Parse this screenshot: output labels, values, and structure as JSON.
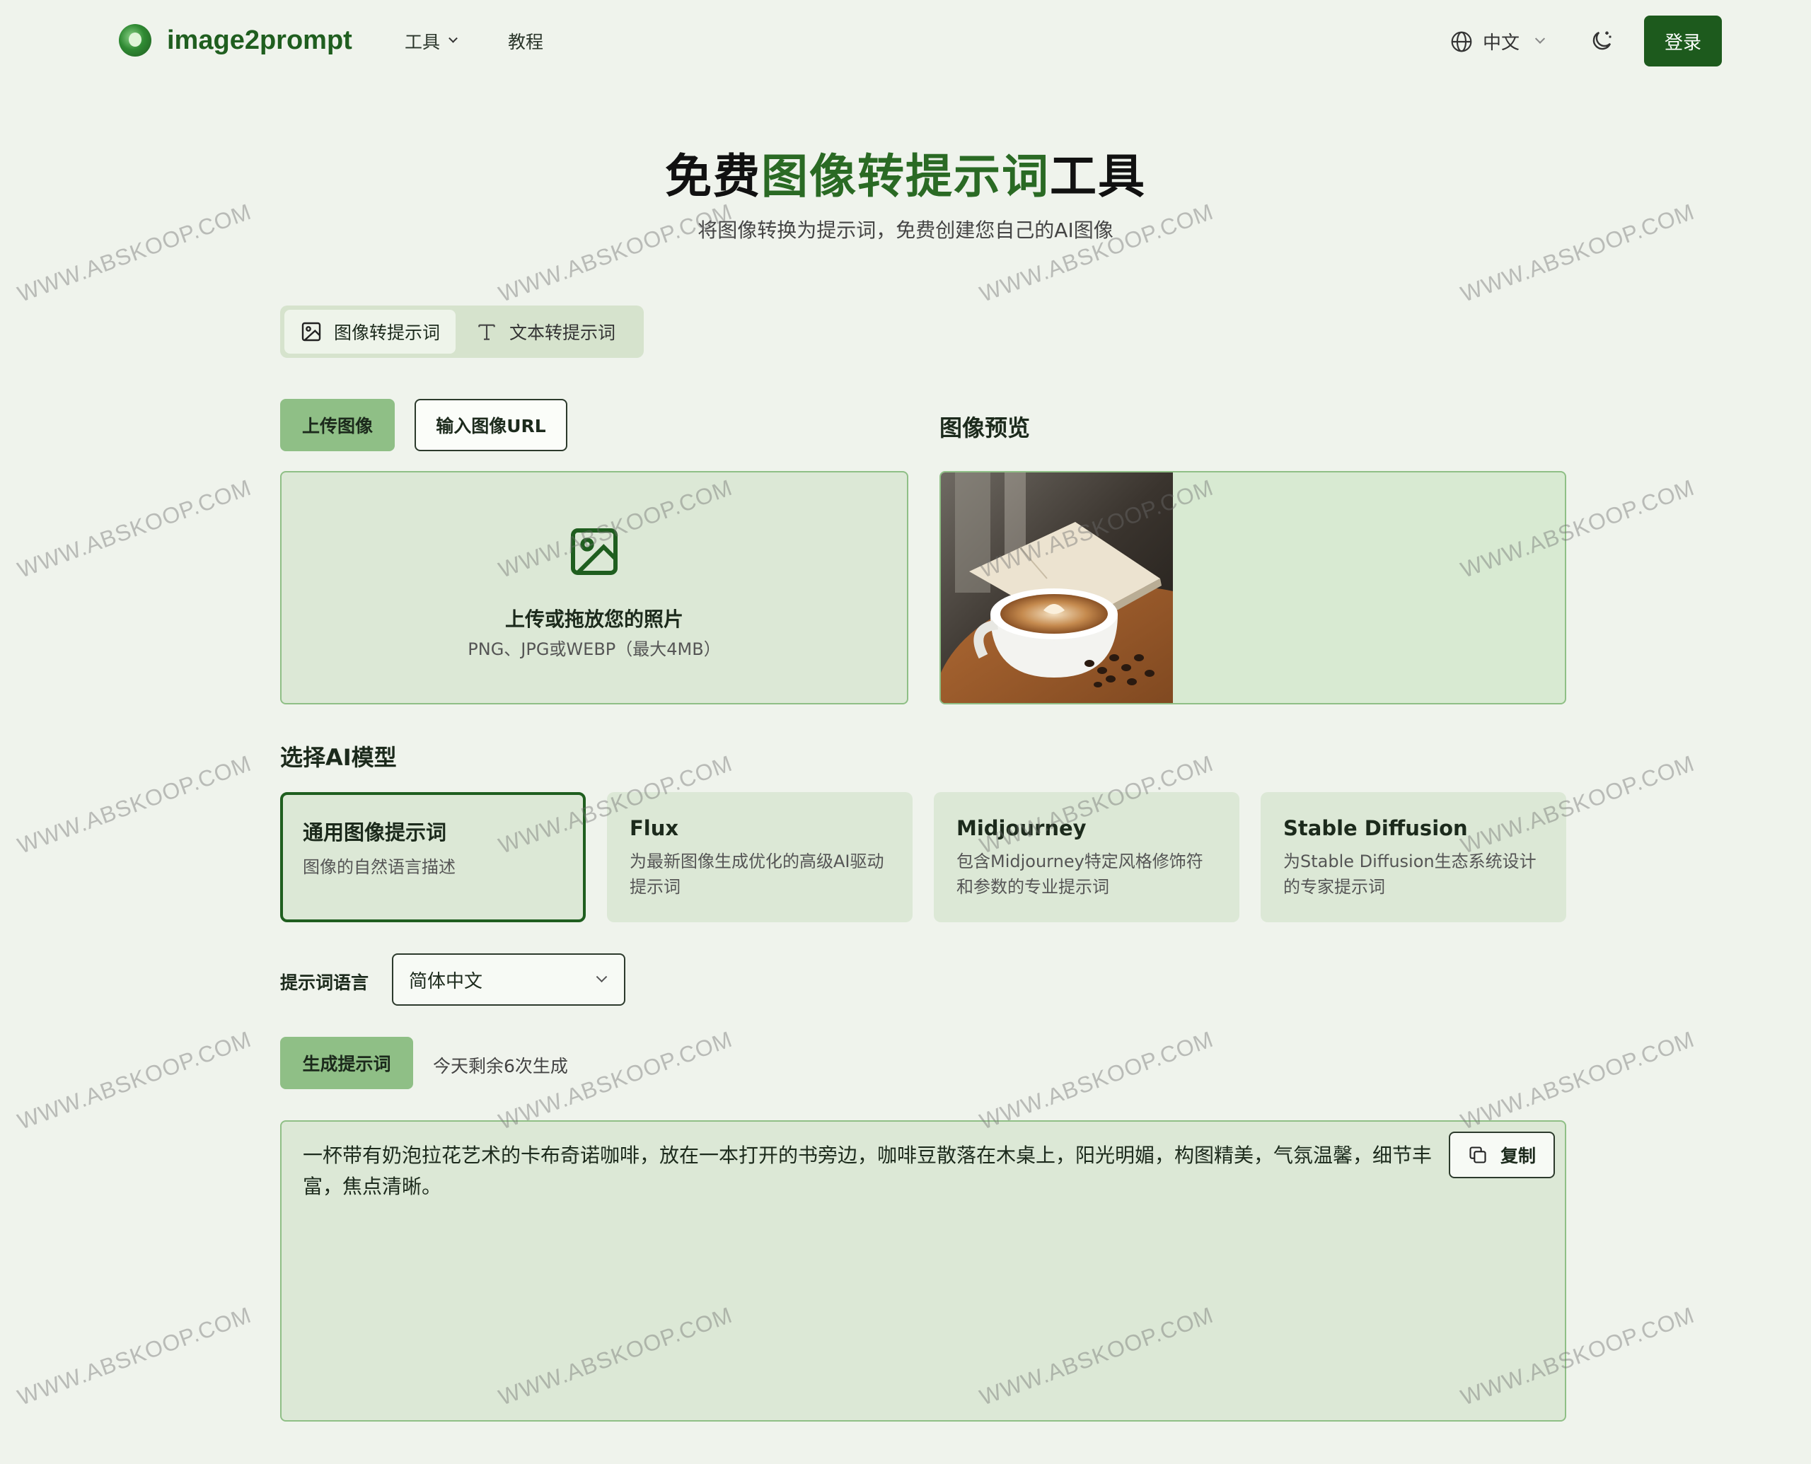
{
  "nav": {
    "brand": "image2prompt",
    "tools_label": "工具",
    "tutorial_label": "教程",
    "language_label": "中文",
    "login_label": "登录"
  },
  "hero": {
    "title_prefix": "免费",
    "title_accent": "图像转提示词",
    "title_suffix": "工具",
    "subtitle": "将图像转换为提示词，免费创建您自己的AI图像"
  },
  "mode_tabs": [
    {
      "label": "图像转提示词",
      "icon": "image-icon",
      "active": true
    },
    {
      "label": "文本转提示词",
      "icon": "text-icon",
      "active": false
    }
  ],
  "upload": {
    "upload_label": "上传图像",
    "url_label": "输入图像URL",
    "drop_title": "上传或拖放您的照片",
    "drop_sub": "PNG、JPG或WEBP（最大4MB）",
    "preview_title": "图像预览"
  },
  "models": {
    "title": "选择AI模型",
    "items": [
      {
        "title": "通用图像提示词",
        "desc": "图像的自然语言描述",
        "active": true
      },
      {
        "title": "Flux",
        "desc": "为最新图像生成优化的高级AI驱动提示词",
        "active": false
      },
      {
        "title": "Midjourney",
        "desc": "包含Midjourney特定风格修饰符和参数的专业提示词",
        "active": false
      },
      {
        "title": "Stable Diffusion",
        "desc": "为Stable Diffusion生态系统设计的专家提示词",
        "active": false
      }
    ]
  },
  "prompt_language": {
    "label": "提示词语言",
    "value": "简体中文"
  },
  "generate": {
    "label": "生成提示词",
    "remaining": "今天剩余6次生成"
  },
  "output": {
    "text": "一杯带有奶泡拉花艺术的卡布奇诺咖啡，放在一本打开的书旁边，咖啡豆散落在木桌上，阳光明媚，构图精美，气氛温馨，细节丰富，焦点清晰。",
    "copy_label": "复制"
  },
  "watermark": "WWW.ABSKOOP.COM",
  "colors": {
    "accent": "#1f5e1f",
    "accent_light": "#8fbf86",
    "panel": "#dce8d6",
    "background": "#eff3ec"
  }
}
